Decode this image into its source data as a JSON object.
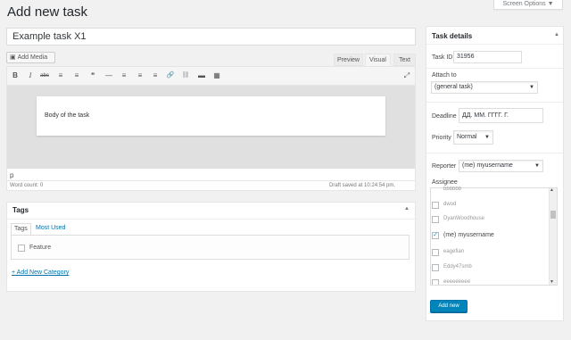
{
  "header": {
    "title": "Add new task",
    "screen_options": "Screen Options ▼"
  },
  "editor": {
    "title_value": "Example task X1",
    "add_media": "Add Media",
    "tabs": [
      "Preview",
      "Visual",
      "Text"
    ],
    "toolbar": {
      "bold": "B",
      "italic": "I",
      "strike": "abc",
      "ul": "≡",
      "ol": "≡",
      "quote": "❝",
      "hr": "—",
      "align_left": "≡",
      "align_center": "≡",
      "align_right": "≡",
      "link": "🔗",
      "unlink": "⛓",
      "more": "▬",
      "kitchen": "▦",
      "fullscreen": "⤢"
    },
    "body_text": "Body of the task",
    "path": "p",
    "word_count": "Word count: 0",
    "draft_saved": "Draft saved at 10:24:54 pm."
  },
  "tags": {
    "title": "Tags",
    "toggle": "▲",
    "tab_tags": "Tags",
    "tab_most_used": "Most Used",
    "items": [
      "Feature"
    ],
    "add_category": "+ Add New Category"
  },
  "details": {
    "title": "Task details",
    "toggle": "▲",
    "task_id_label": "Task ID",
    "task_id_value": "31956",
    "attach_label": "Attach to",
    "attach_value": "(general task)",
    "deadline_label": "Deadline",
    "deadline_value": "ДД. ММ. ГГГГ. Г.",
    "priority_label": "Priority",
    "priority_value": "Normal",
    "reporter_label": "Reporter",
    "reporter_value": "(me) myusername",
    "assignee_label": "Assignee",
    "assignees": [
      {
        "name": "bbbbbb",
        "checked": false
      },
      {
        "name": "dwod",
        "checked": false
      },
      {
        "name": "DyanWoodhouse",
        "checked": false
      },
      {
        "name": "(me) myusername",
        "checked": true
      },
      {
        "name": "eagefian",
        "checked": false
      },
      {
        "name": "Eddy47smb",
        "checked": false
      },
      {
        "name": "eeeeeeeee",
        "checked": false
      }
    ],
    "add_new": "Add new"
  }
}
